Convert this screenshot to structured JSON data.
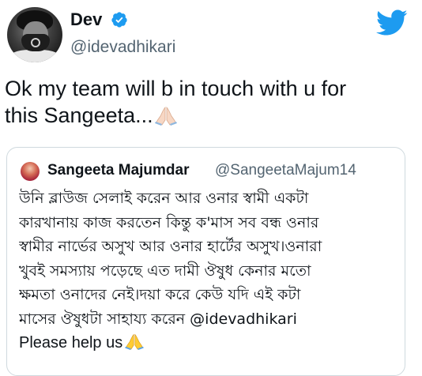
{
  "author": {
    "display_name": "Dev",
    "handle": "@idevadhikari",
    "verified": true
  },
  "tweet": {
    "text_line1": "Ok my team will b in touch with u for",
    "text_line2": "this Sangeeta...",
    "emoji": "folded-hands (light skin tone)"
  },
  "quoted_tweet": {
    "display_name": "Sangeeta Majumdar",
    "handle": "@SangeetaMajum14",
    "lines": [
      "উনি ব্লাউজ সেলাই করেন আর ওনার স্বামী একটা",
      "কারখানায় কাজ করতেন কিন্তু ক'মাস সব বন্ধ ওনার",
      "স্বামীর নার্ভের অসুখ আর ওনার হার্টের অসুখ।ওনারা",
      "খুবই সমস্যায় পড়েছে এত দামী ঔষুধ কেনার মতো",
      "ক্ষমতা ওনাদের নেই।দয়া করে কেউ যদি এই কটা",
      "মাসের ঔষুধটা সাহায্য করেন @idevadhikari",
      "Please help us"
    ],
    "emoji": "folded-hands"
  },
  "colors": {
    "twitter_blue": "#1d9bf0",
    "text_primary": "#0f1419",
    "text_secondary": "#536471",
    "border": "#cfd9de"
  },
  "icons": [
    "verified-badge-icon",
    "twitter-bird-icon",
    "folded-hands-emoji"
  ]
}
